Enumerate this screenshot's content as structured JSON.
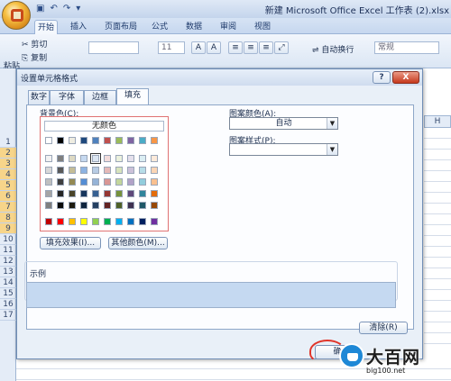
{
  "window": {
    "title": "新建 Microsoft Office Excel 工作表 (2).xlsx"
  },
  "ribbon": {
    "tabs": [
      "开始",
      "插入",
      "页面布局",
      "公式",
      "数据",
      "审阅",
      "视图"
    ],
    "cut_label": "剪切",
    "copy_label": "复制",
    "paste_label": "粘贴",
    "font_size": "11",
    "wrap_text_label": "自动换行",
    "number_format": "常规"
  },
  "sheet": {
    "row_numbers": [
      "1",
      "2",
      "3",
      "4",
      "5",
      "6",
      "7",
      "8",
      "9",
      "10",
      "11",
      "12",
      "13",
      "14",
      "15",
      "16",
      "17"
    ],
    "column_label": "H"
  },
  "dialog": {
    "title": "设置单元格格式",
    "help_label": "?",
    "close_label": "X",
    "tabs": [
      "数字",
      "字体",
      "边框",
      "填充"
    ],
    "active_tab": "填充",
    "background_color_label": "背景色(C):",
    "no_color_label": "无颜色",
    "fill_effects_button": "填充效果(I)...",
    "more_colors_button": "其他颜色(M)...",
    "pattern_color_label": "图案颜色(A):",
    "pattern_color_value": "自动",
    "pattern_style_label": "图案样式(P):",
    "pattern_style_value": "",
    "sample_label": "示例",
    "clear_button": "清除(R)",
    "ok_button": "确",
    "sample_color": "#c5d9f1",
    "palette": {
      "theme_top": [
        "#ffffff",
        "#000000",
        "#eeece1",
        "#1f497d",
        "#4f81bd",
        "#c0504d",
        "#9bbb59",
        "#8064a2",
        "#4bacc6",
        "#f79646"
      ],
      "theme_shades": [
        [
          "#f2f2f2",
          "#7f7f7f",
          "#ddd9c3",
          "#c6d9f0",
          "#dbe5f1",
          "#f2dcdb",
          "#ebf1dd",
          "#e5e0ec",
          "#dbeef3",
          "#fdeada"
        ],
        [
          "#d8d8d8",
          "#595959",
          "#c4bd97",
          "#8db3e2",
          "#b8cce4",
          "#e5b9b7",
          "#d7e3bc",
          "#ccc1d9",
          "#b7dde8",
          "#fbd5b5"
        ],
        [
          "#bfbfbf",
          "#3f3f3f",
          "#938953",
          "#548dd4",
          "#95b3d7",
          "#d99694",
          "#c3d69b",
          "#b2a2c7",
          "#92cddc",
          "#fac08f"
        ],
        [
          "#a5a5a5",
          "#262626",
          "#494429",
          "#17365d",
          "#366092",
          "#953734",
          "#76923c",
          "#5f497a",
          "#31859b",
          "#e36c09"
        ],
        [
          "#7f7f7f",
          "#0c0c0c",
          "#1d1b10",
          "#0f243e",
          "#244061",
          "#632423",
          "#4f6128",
          "#3f3151",
          "#205867",
          "#974806"
        ]
      ],
      "standard": [
        "#c00000",
        "#ff0000",
        "#ffc000",
        "#ffff00",
        "#92d050",
        "#00b050",
        "#00b0f0",
        "#0070c0",
        "#002060",
        "#7030a0"
      ],
      "selected_index": [
        0,
        4
      ]
    }
  },
  "watermark": {
    "name": "大百网",
    "url": "big100.net"
  }
}
